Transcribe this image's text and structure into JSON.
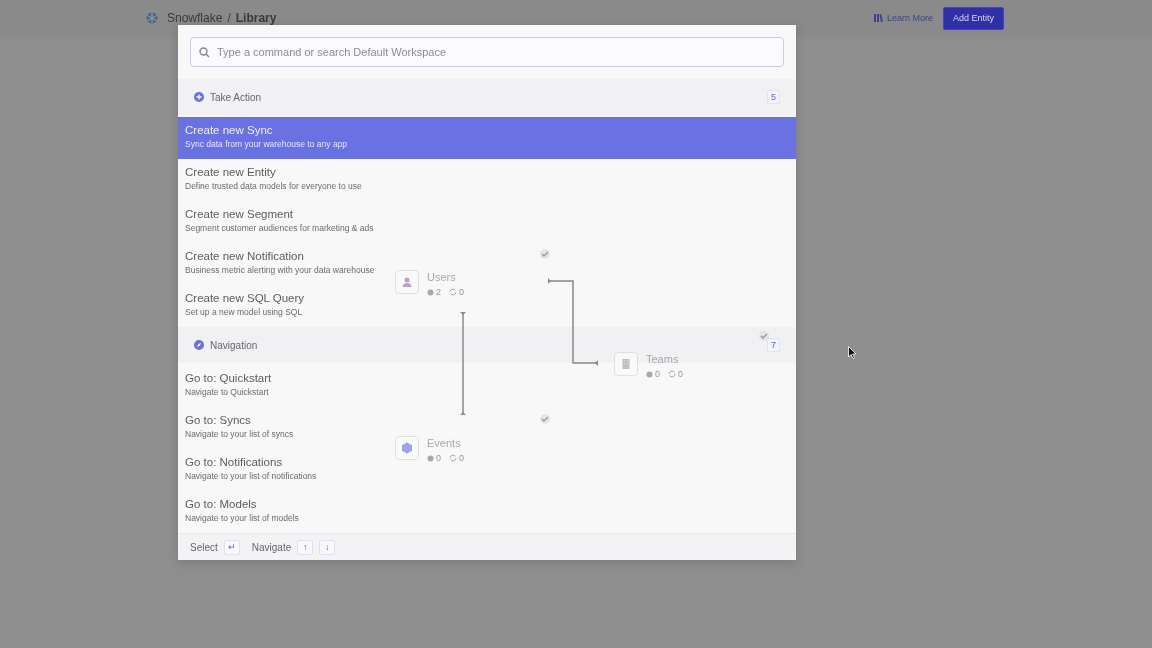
{
  "topbar": {
    "workspace": "Snowflake",
    "separator": "/",
    "page": "Library",
    "links": [
      {
        "label": "Learn More",
        "kind": "link"
      },
      {
        "label": "Add Entity",
        "kind": "primary"
      }
    ]
  },
  "palette": {
    "search": {
      "placeholder": "Type a command or search Default Workspace"
    },
    "sections": [
      {
        "title": "Take Action",
        "count": "5",
        "items": [
          {
            "title": "Create new Sync",
            "description": "Sync data from your warehouse to any app",
            "selected": true
          },
          {
            "title": "Create new Entity",
            "description": "Define trusted data models for everyone to use",
            "selected": false
          },
          {
            "title": "Create new Segment",
            "description": "Segment customer audiences for marketing & ads",
            "selected": false
          },
          {
            "title": "Create new Notification",
            "description": "Business metric alerting with your data warehouse",
            "selected": false
          },
          {
            "title": "Create new SQL Query",
            "description": "Set up a new model using SQL",
            "selected": false
          }
        ]
      },
      {
        "title": "Navigation",
        "count": "7",
        "items": [
          {
            "title": "Go to: Quickstart",
            "description": "Navigate to Quickstart",
            "selected": false
          },
          {
            "title": "Go to: Syncs",
            "description": "Navigate to your list of syncs",
            "selected": false
          },
          {
            "title": "Go to: Notifications",
            "description": "Navigate to your list of notifications",
            "selected": false
          },
          {
            "title": "Go to: Models",
            "description": "Navigate to your list of models",
            "selected": false
          }
        ]
      }
    ],
    "footer": [
      {
        "label": "Select",
        "keys": [
          "↵"
        ]
      },
      {
        "label": "Navigate",
        "keys": [
          "↑",
          "↓"
        ]
      }
    ]
  },
  "diagram": {
    "nodes": [
      {
        "name": "Users",
        "kind": "person",
        "stats": [
          "2",
          "0"
        ]
      },
      {
        "name": "Teams",
        "kind": "building",
        "stats": [
          "0",
          "0"
        ]
      },
      {
        "name": "Events",
        "kind": "event",
        "stats": [
          "0",
          "0"
        ]
      }
    ]
  }
}
